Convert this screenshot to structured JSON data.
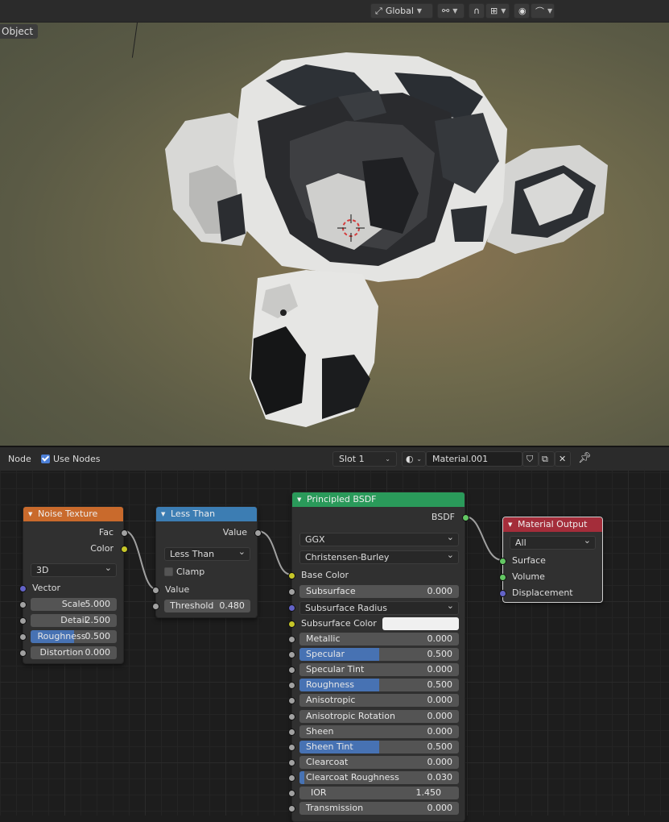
{
  "viewport": {
    "mode_label": "Object",
    "header": {
      "transform_orientation": "Global"
    }
  },
  "node_editor": {
    "header": {
      "menu_node": "Node",
      "use_nodes_label": "Use Nodes",
      "use_nodes_checked": true,
      "slot": "Slot 1",
      "material_name": "Material.001"
    },
    "nodes": {
      "noise": {
        "title": "Noise Texture",
        "color": "#c96a2c",
        "outputs": [
          "Fac",
          "Color"
        ],
        "dimensions": "3D",
        "vector_label": "Vector",
        "fields": [
          {
            "label": "Scale",
            "value": "5.000"
          },
          {
            "label": "Detail",
            "value": "2.500"
          },
          {
            "label": "Roughness",
            "value": "0.500",
            "fill": 0.5
          },
          {
            "label": "Distortion",
            "value": "0.000"
          }
        ]
      },
      "math": {
        "title": "Less Than",
        "color": "#3c7db3",
        "output": "Value",
        "operation": "Less Than",
        "clamp_label": "Clamp",
        "clamp_checked": false,
        "input_label": "Value",
        "threshold_label": "Threshold",
        "threshold_value": "0.480"
      },
      "bsdf": {
        "title": "Principled BSDF",
        "color": "#2a9a5a",
        "output": "BSDF",
        "distribution": "GGX",
        "subsurface_method": "Christensen-Burley",
        "base_color_label": "Base Color",
        "subsurface_radius_label": "Subsurface Radius",
        "subsurface_color_label": "Subsurface Color",
        "subsurface_color": "#f0f0f0",
        "fields_a": [
          {
            "label": "Subsurface",
            "value": "0.000"
          }
        ],
        "fields_b": [
          {
            "label": "Metallic",
            "value": "0.000"
          },
          {
            "label": "Specular",
            "value": "0.500",
            "fill": 0.5
          },
          {
            "label": "Specular Tint",
            "value": "0.000"
          },
          {
            "label": "Roughness",
            "value": "0.500",
            "fill": 0.5
          },
          {
            "label": "Anisotropic",
            "value": "0.000"
          },
          {
            "label": "Anisotropic Rotation",
            "value": "0.000"
          },
          {
            "label": "Sheen",
            "value": "0.000"
          },
          {
            "label": "Sheen Tint",
            "value": "0.500",
            "fill": 0.5
          },
          {
            "label": "Clearcoat",
            "value": "0.000"
          },
          {
            "label": "Clearcoat Roughness",
            "value": "0.030",
            "fill": 0.03
          },
          {
            "label": "IOR",
            "value": "1.450"
          },
          {
            "label": "Transmission",
            "value": "0.000"
          }
        ]
      },
      "output": {
        "title": "Material Output",
        "color": "#a42d3a",
        "target": "All",
        "inputs": [
          "Surface",
          "Volume",
          "Displacement"
        ]
      }
    }
  }
}
